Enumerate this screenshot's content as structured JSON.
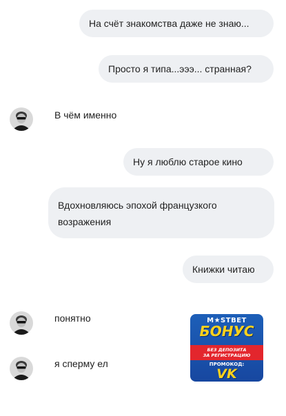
{
  "messages": [
    {
      "side": "outgoing",
      "text": "На счёт знакомства даже не знаю..."
    },
    {
      "side": "outgoing",
      "text": "Просто я типа...эээ... странная?"
    },
    {
      "side": "incoming",
      "text": "В чём именно"
    },
    {
      "side": "outgoing",
      "text": "Ну я люблю старое кино"
    },
    {
      "side": "outgoing",
      "text": "Вдохновляюсь эпохой французкого возражения",
      "lines": [
        "Вдохновляюсь эпохой французкого",
        "возражения"
      ]
    },
    {
      "side": "outgoing",
      "text": "Книжки читаю"
    },
    {
      "side": "incoming",
      "text": "понятно"
    },
    {
      "side": "incoming",
      "text": "я сперму ел"
    }
  ],
  "avatar_icon": "user-avatar-sunglasses",
  "promo": {
    "brand": "M★STBET",
    "bonus": "БОНУС",
    "band_line1": "БЕЗ ДЕПОЗИТА",
    "band_line2": "ЗА РЕГИСТРАЦИЮ",
    "code_label": "ПРОМОКОД:",
    "code": "VK"
  },
  "colors": {
    "bubble": "#eef0f3",
    "text": "#222222",
    "promo_blue": "#1d5fb8",
    "promo_yellow": "#ffd21c",
    "promo_red": "#e3262d"
  }
}
